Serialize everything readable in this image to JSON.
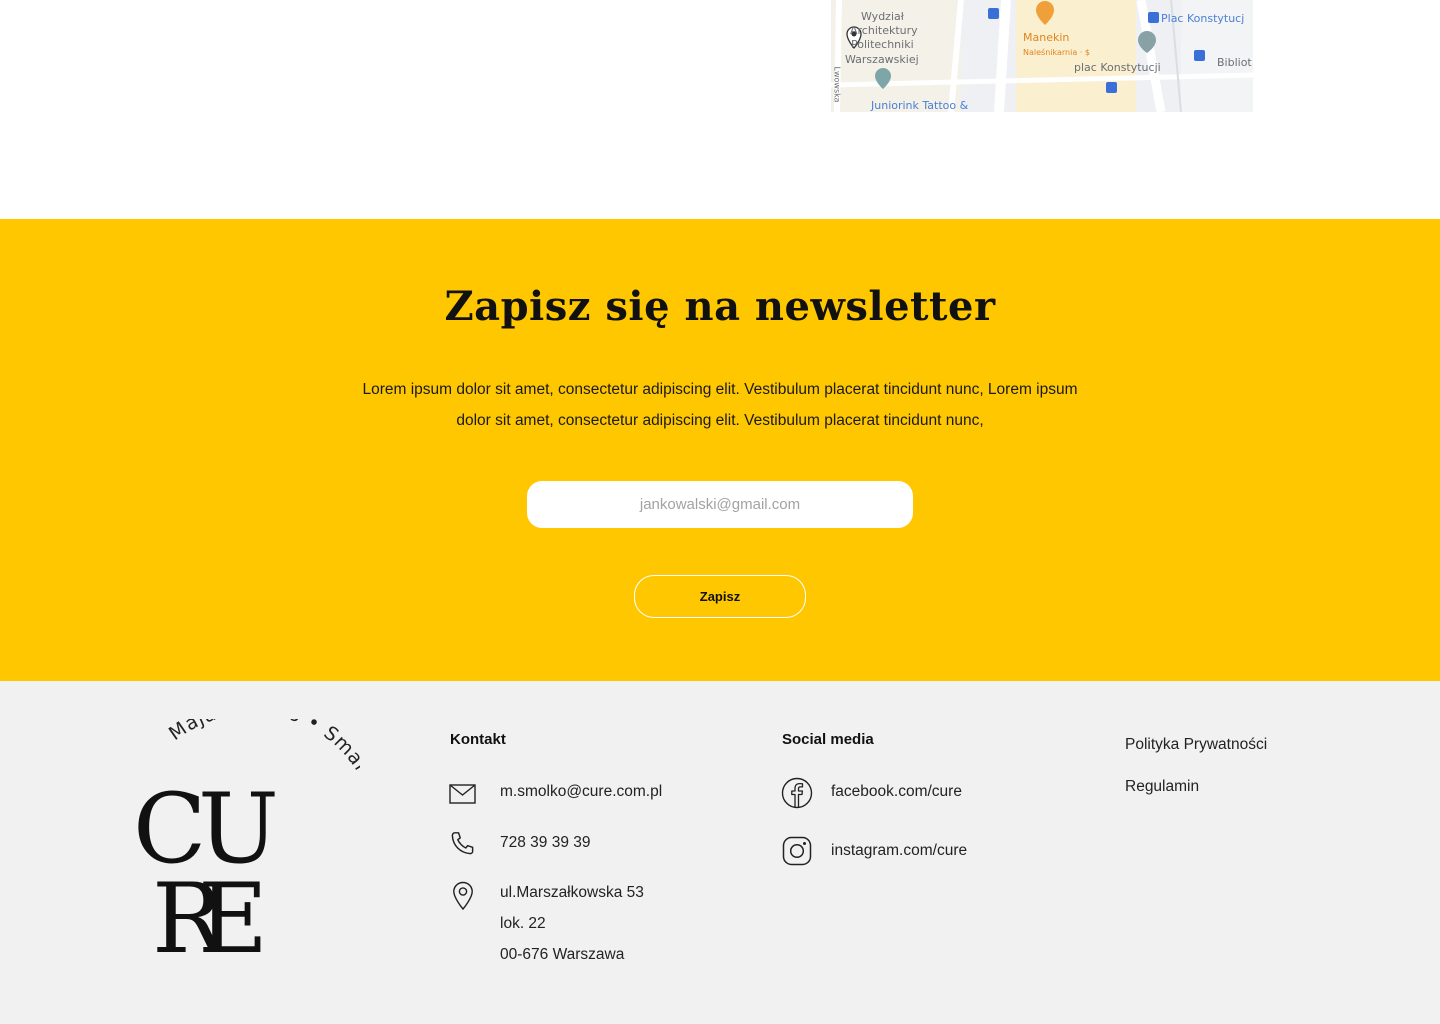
{
  "map": {
    "labels": {
      "wydzial_1": "Wydział",
      "wydzial_2": "Architektury",
      "wydzial_3": "Politechniki",
      "wydzial_4": "Warszawskiej",
      "manekin": "Manekin",
      "nalesnikarnia": "Naleśnikarnia · $",
      "plac_konstytucji_top": "Plac Konstytucj",
      "plac_konstytucji": "plac Konstytucji",
      "bibliot": "Bibliot",
      "juniorink": "Juniorink Tattoo &",
      "street": "Lwowska"
    }
  },
  "newsletter": {
    "title": "Zapisz się na newsletter",
    "text": "Lorem ipsum dolor sit amet, consectetur adipiscing elit. Vestibulum placerat tincidunt nunc, Lorem ipsum dolor sit amet, consectetur adipiscing elit. Vestibulum placerat tincidunt nunc,",
    "email_placeholder": "jankowalski@gmail.com",
    "submit_label": "Zapisz",
    "background_color": "#ffc700"
  },
  "footer": {
    "logo": {
      "arc_text": "Maja Smółko • Smart Aging",
      "letters": "CURE"
    },
    "contact": {
      "title": "Kontakt",
      "email": "m.smolko@cure.com.pl",
      "phone": "728 39 39 39",
      "address_line1": "ul.Marszałkowska 53",
      "address_line2": "lok. 22",
      "address_line3": "00-676 Warszawa"
    },
    "social": {
      "title": "Social media",
      "facebook": "facebook.com/cure",
      "instagram": "instagram.com/cure"
    },
    "links": {
      "privacy": "Polityka Prywatności",
      "terms": "Regulamin"
    }
  }
}
